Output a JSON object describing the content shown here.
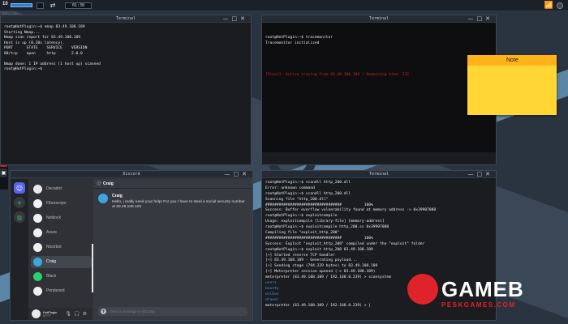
{
  "taskbar": {
    "level": "10",
    "xp_fill": 0.9,
    "cpu_fill": 0.42,
    "clock": "01:30"
  },
  "watermark_logo": {
    "text": "GAMEB",
    "sub": "PESKGAMES.COM"
  },
  "dock": {
    "brand": "Hack Plugin"
  },
  "terminal1": {
    "title": "Terminal",
    "lines": [
      "root@HotPlugin:~$ nmap 83.49.108.109",
      "Starting Nmap...",
      "Nmap scan report for 83.49.108.109",
      "Host is up (0.30s latency).",
      "PORT      STATE    SERVICE    VERSION",
      "80/tcp    open     http       2.0.0",
      "",
      "Nmap done: 1 IP address (1 host up) scanned",
      "root@HotPlugin:~$"
    ]
  },
  "terminal2": {
    "title": "Terminal",
    "lines": [
      "root@HotPlugin:~$ tracemonitor",
      "Tracemonitor initialized"
    ],
    "alert": "[Trace]: Active tracing from 83.49.108.109 / Remaining time: 232"
  },
  "note": {
    "title": "Note"
  },
  "discord": {
    "title": "Discord",
    "contacts": [
      {
        "name": "Decadict",
        "color": "#e9e9e9",
        "active": false
      },
      {
        "name": "Fiberscope",
        "color": "#f2f2f2",
        "active": false
      },
      {
        "name": "Noblock",
        "color": "#f0f0f0",
        "active": false
      },
      {
        "name": "Azure",
        "color": "#f0f0f0",
        "active": false
      },
      {
        "name": "Nicorbot",
        "color": "#f0f0f0",
        "active": false
      },
      {
        "name": "Craig",
        "color": "#3aa7e0",
        "active": true
      },
      {
        "name": "Black",
        "color": "#2ecc71",
        "active": false
      },
      {
        "name": "Perplexed",
        "color": "#f0f0f0",
        "active": false
      }
    ],
    "user": {
      "name": "HotPlugin",
      "tag": "#7777"
    },
    "chat": {
      "channel": "Craig",
      "messages": [
        {
          "author": "Craig",
          "text": "Hello, i really need your help! For you I have to steal a social security number at 83.49.108.109"
        }
      ],
      "input_placeholder": "Send a message to @Craig"
    }
  },
  "terminal3": {
    "title": "Terminal",
    "lines": [
      {
        "text": "root@HotPlugin:~$ scandll http_200.dll",
        "color": "#e9edf2"
      },
      {
        "text": "Error: unknown command",
        "color": "#e9edf2"
      },
      {
        "text": "root@HotPlugin:~$ scandll http_200.dll",
        "color": "#e9edf2"
      },
      {
        "text": "Scanning file \"http_200.dll\"",
        "color": "#e9edf2"
      },
      {
        "text": "##################################          100%",
        "color": "#e9edf2"
      },
      {
        "text": "Success: Buffer overflow vulnerability found at memory address -> 0x39907080",
        "color": "#e9edf2"
      },
      {
        "text": "root@HotPlugin:~$ exploitcompile",
        "color": "#e9edf2"
      },
      {
        "text": "Usage: exploitcompile [library-file] [memory-address]",
        "color": "#e9edf2"
      },
      {
        "text": "root@HotPlugin:~$ exploitcompile http_200.ss 0x39907080",
        "color": "#e9edf2"
      },
      {
        "text": "Compiling file \"exploit_http_200\"",
        "color": "#e9edf2"
      },
      {
        "text": "##################################          100%",
        "color": "#e9edf2"
      },
      {
        "text": "Success: Exploit \"exploit_http_200\" compiled under the \"exploit\" folder",
        "color": "#e9edf2"
      },
      {
        "text": "root@HotPlugin:~$ exploit http_200 83.49.108.109",
        "color": "#e9edf2"
      },
      {
        "text": "[+] Started reverse TCP handler",
        "color": "#e9edf2"
      },
      {
        "text": "[+] 83.49.108.109 - Generating payload...",
        "color": "#e9edf2"
      },
      {
        "text": "[+] Sending stage (794.229 bytes) to 83.49.108.109",
        "color": "#e9edf2"
      },
      {
        "text": "[+] Meterpreter session opened (-> 83.49.108.109)",
        "color": "#e9edf2"
      },
      {
        "text": "meterpreter (83.49.108.109 / 192.168.0.239) > scansystem",
        "color": "#e9edf2"
      },
      {
        "text": "users",
        "color": "#4f8fd6"
      },
      {
        "text": "bounty",
        "color": "#4f8fd6"
      },
      {
        "text": "wilbox",
        "color": "#4f8fd6"
      },
      {
        "text": "drawer",
        "color": "#4f8fd6"
      },
      {
        "text": "meterpreter (83.49.108.109 / 192.168.0.239) > |",
        "color": "#e9edf2"
      }
    ]
  },
  "colors": {
    "terminal_alert": "#d2262a",
    "discord_accent": "#5865f2",
    "note_yellow": "#ffd633",
    "note_header": "#ffb21a",
    "watermark_red": "#e0232b"
  }
}
